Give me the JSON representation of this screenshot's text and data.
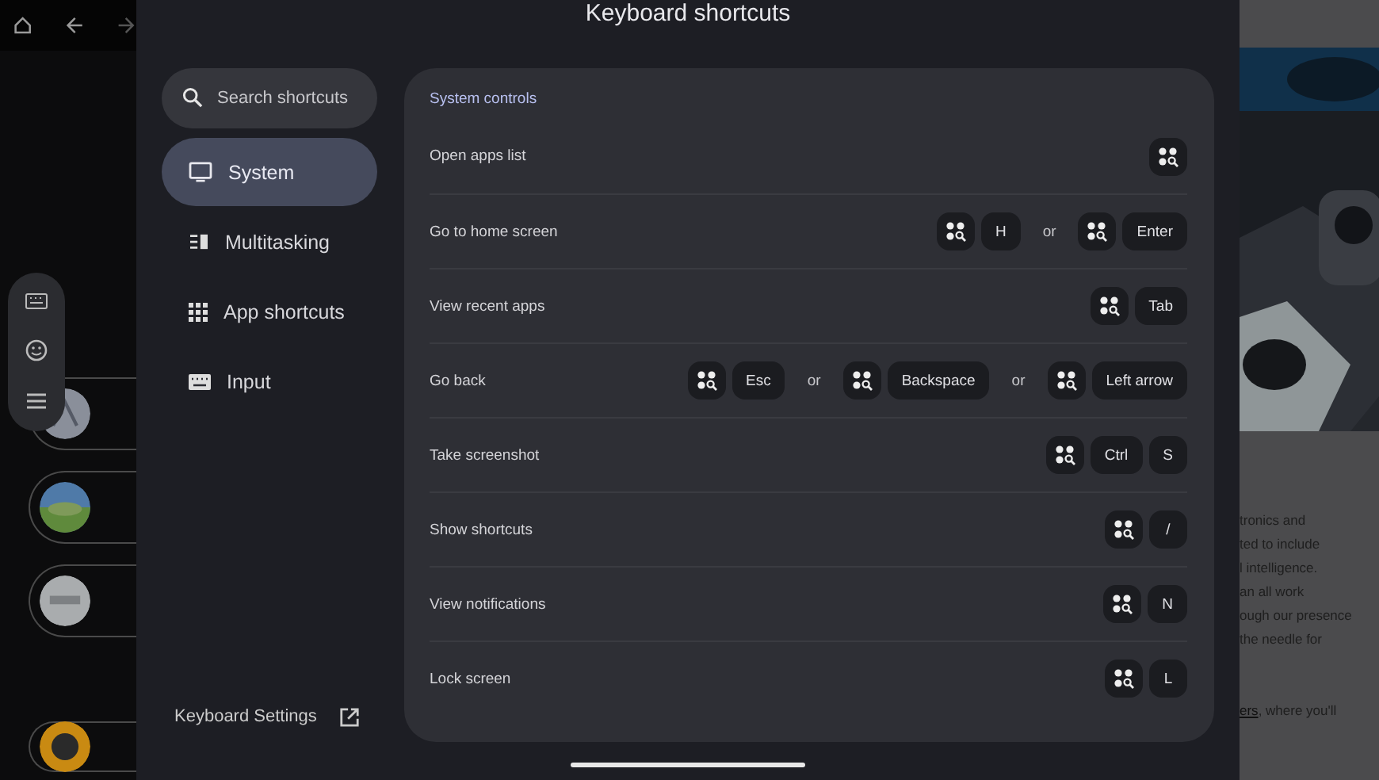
{
  "title": "Keyboard shortcuts",
  "search": {
    "placeholder": "Search shortcuts"
  },
  "categories": [
    {
      "label": "System",
      "kind": "monitor",
      "selected": true
    },
    {
      "label": "Multitasking",
      "kind": "split",
      "selected": false
    },
    {
      "label": "App shortcuts",
      "kind": "grid",
      "selected": false
    },
    {
      "label": "Input",
      "kind": "keyboard",
      "selected": false
    }
  ],
  "keyboard_settings": "Keyboard Settings",
  "section_title": "System controls",
  "shortcuts": [
    {
      "label": "Open apps list",
      "keys": [
        {
          "kind": "meta"
        }
      ]
    },
    {
      "label": "Go to home screen",
      "keys": [
        {
          "kind": "meta"
        },
        {
          "kind": "key",
          "text": "H"
        },
        {
          "kind": "separator",
          "text": "or"
        },
        {
          "kind": "meta"
        },
        {
          "kind": "key",
          "text": "Enter"
        }
      ]
    },
    {
      "label": "View recent apps",
      "keys": [
        {
          "kind": "meta"
        },
        {
          "kind": "key",
          "text": "Tab"
        }
      ]
    },
    {
      "label": "Go back",
      "keys": [
        {
          "kind": "meta"
        },
        {
          "kind": "key",
          "text": "Esc"
        },
        {
          "kind": "separator",
          "text": "or"
        },
        {
          "kind": "meta"
        },
        {
          "kind": "key",
          "text": "Backspace"
        },
        {
          "kind": "separator",
          "text": "or"
        },
        {
          "kind": "meta"
        },
        {
          "kind": "key",
          "text": "Left arrow"
        }
      ]
    },
    {
      "label": "Take screenshot",
      "keys": [
        {
          "kind": "meta"
        },
        {
          "kind": "key",
          "text": "Ctrl"
        },
        {
          "kind": "key",
          "text": "S"
        }
      ]
    },
    {
      "label": "Show shortcuts",
      "keys": [
        {
          "kind": "meta"
        },
        {
          "kind": "key",
          "text": "/"
        }
      ]
    },
    {
      "label": "View notifications",
      "keys": [
        {
          "kind": "meta"
        },
        {
          "kind": "key",
          "text": "N"
        }
      ]
    },
    {
      "label": "Lock screen",
      "keys": [
        {
          "kind": "meta"
        },
        {
          "kind": "key",
          "text": "L"
        }
      ]
    }
  ],
  "background_page": {
    "lines": [
      "tronics and",
      "ted to include",
      "l intelligence.",
      "an all work",
      "ough our presence",
      "the needle for"
    ],
    "link": "ers",
    "link_tail": ", where you'll"
  }
}
